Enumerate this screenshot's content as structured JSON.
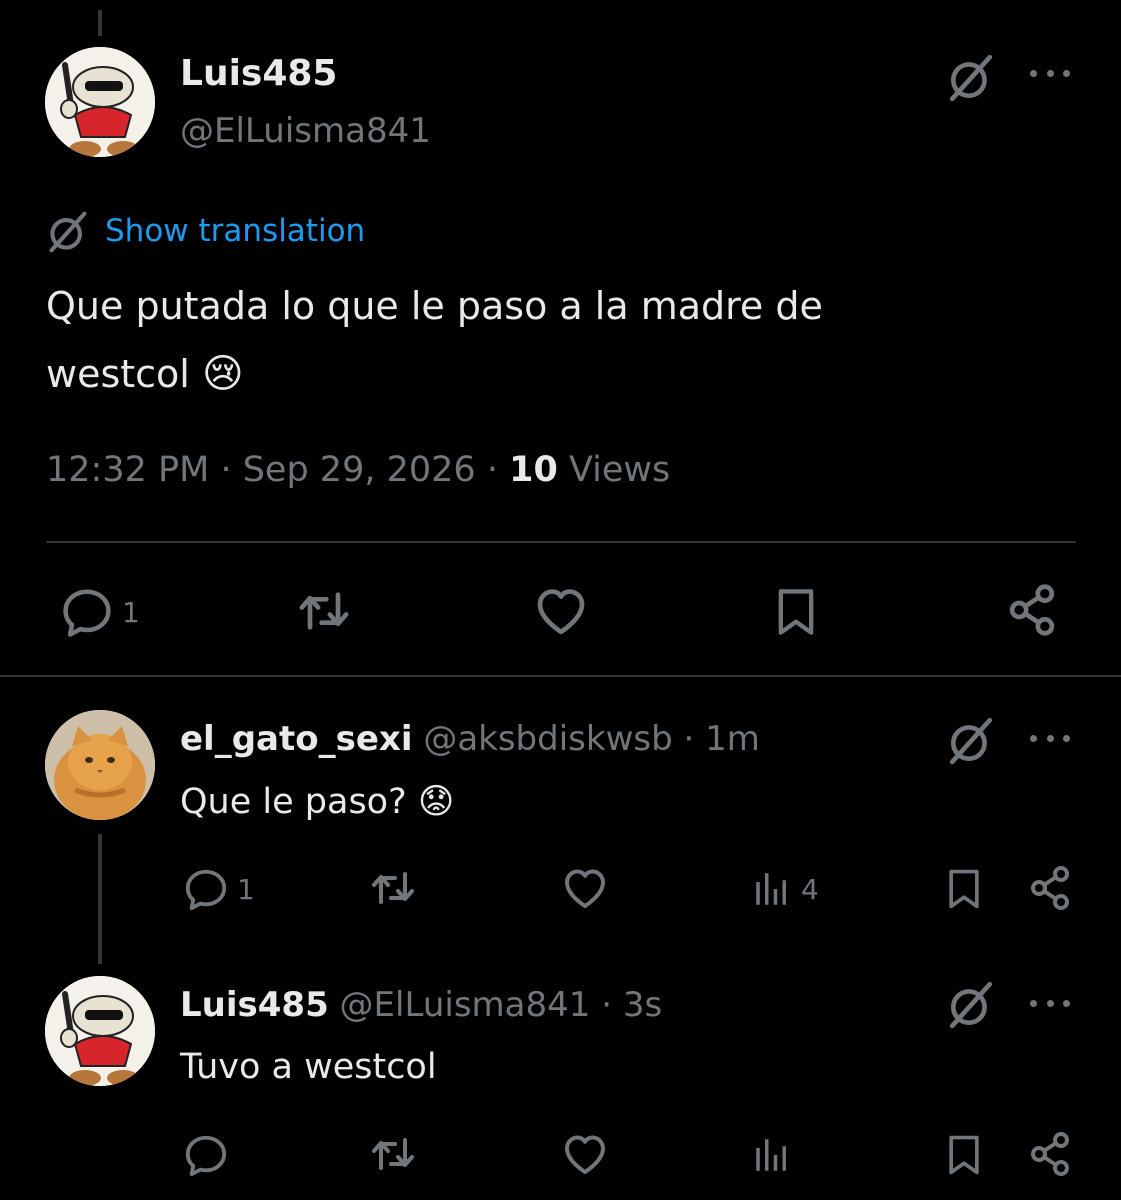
{
  "thread_line_color": "#333639",
  "main_tweet": {
    "display_name": "Luis485",
    "handle": "@ElLuisma841",
    "translate_label": "Show translation",
    "text_line1": "Que putada lo que le paso a la madre de",
    "text_line2": "westcol",
    "emoji": "😢",
    "time": "12:32 PM",
    "sep1": "·",
    "date": "Sep 29, 2026",
    "sep2": "·",
    "views_count": "10",
    "views_label": "Views",
    "reply_count": "1",
    "accent_color": "#1d9bf0"
  },
  "reply1": {
    "display_name": "el_gato_sexi",
    "handle": "@aksbdiskwsb",
    "sep": "·",
    "time": "1m",
    "text": "Que le paso?",
    "emoji": "😟",
    "reply_count": "1",
    "views_count": "4"
  },
  "reply2": {
    "display_name": "Luis485",
    "handle": "@ElLuisma841",
    "sep": "·",
    "time": "3s",
    "text": "Tuvo a westcol"
  },
  "icons": {
    "grok": "grok-slash-icon",
    "more": "more-dots-icon",
    "reply": "reply-bubble-icon",
    "retweet": "retweet-icon",
    "like": "heart-icon",
    "bookmark": "bookmark-icon",
    "share": "share-nodes-icon",
    "views": "views-bars-icon"
  }
}
